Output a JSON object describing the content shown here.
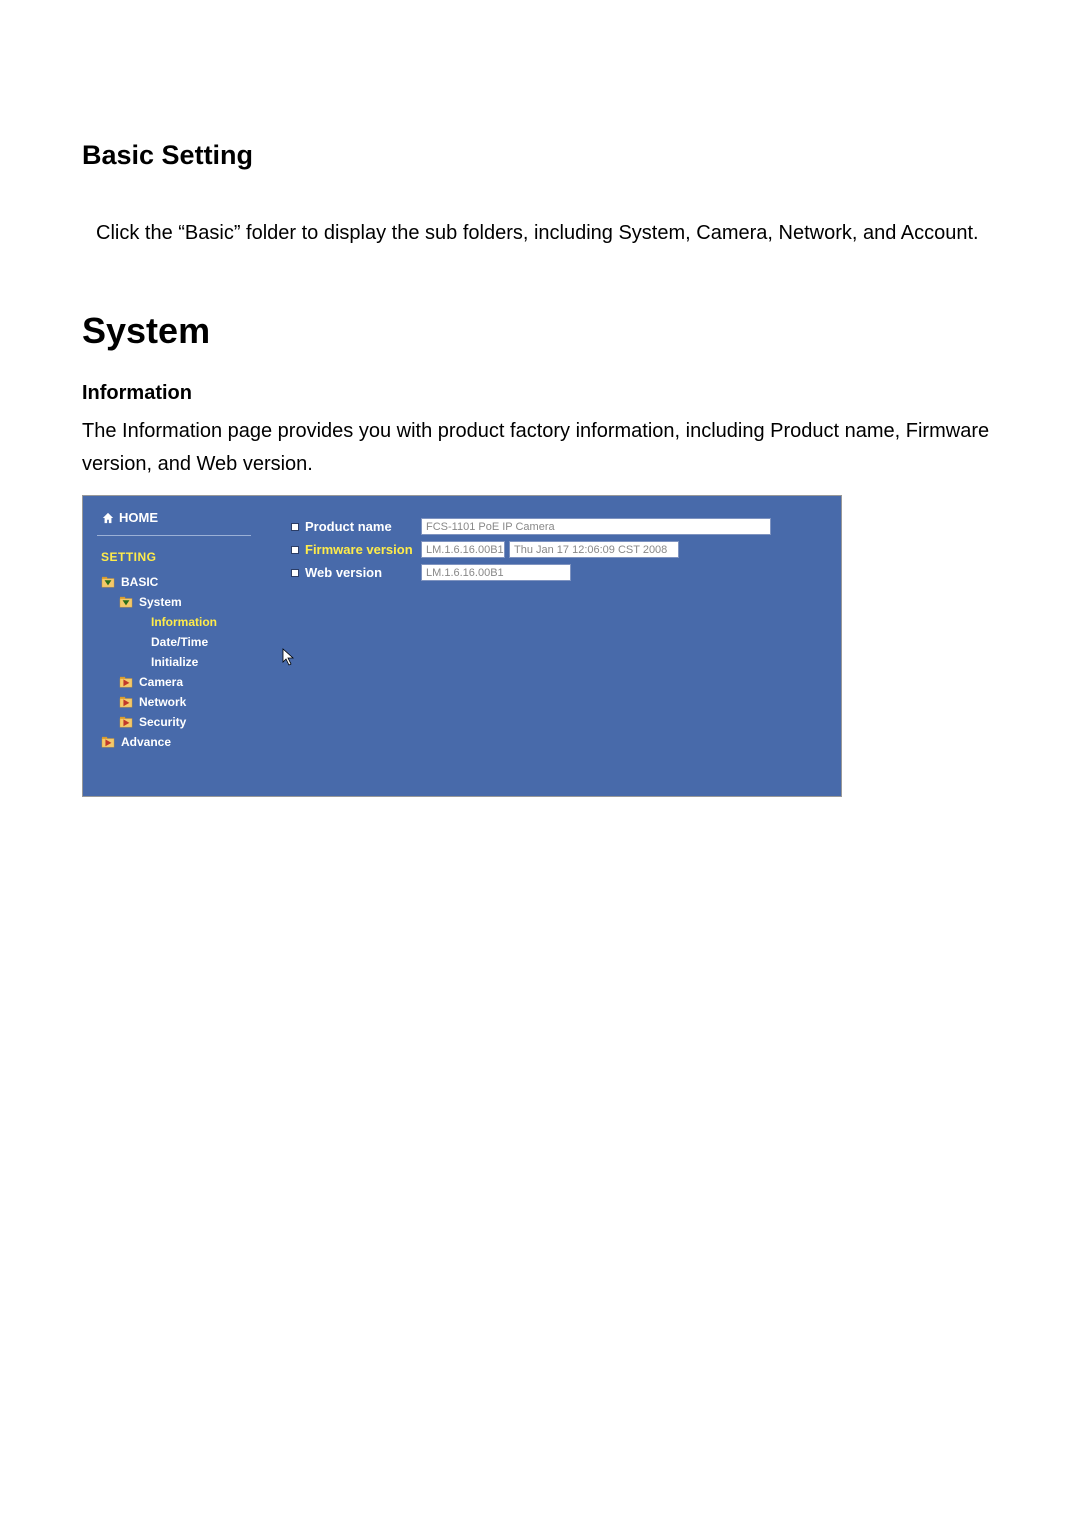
{
  "doc": {
    "heading1": "Basic Setting",
    "para1": "Click the “Basic” folder to display the sub folders, including System, Camera, Network, and Account.",
    "heading2": "System",
    "subheading": "Information",
    "para2": "The Information page provides you with product factory information, including Product name, Firmware version, and Web version."
  },
  "nav": {
    "home": "HOME",
    "setting": "SETTING",
    "basic": "BASIC",
    "system": "System",
    "information": "Information",
    "datetime": "Date/Time",
    "initialize": "Initialize",
    "camera": "Camera",
    "network": "Network",
    "security": "Security",
    "advance": "Advance"
  },
  "info": {
    "product_label": "Product name",
    "product_value": "FCS-1101 PoE IP Camera",
    "firmware_label": "Firmware version",
    "firmware_value": "LM.1.6.16.00B1",
    "firmware_date": "Thu Jan 17 12:06:09 CST 2008",
    "web_label": "Web version",
    "web_value": "LM.1.6.16.00B1"
  }
}
